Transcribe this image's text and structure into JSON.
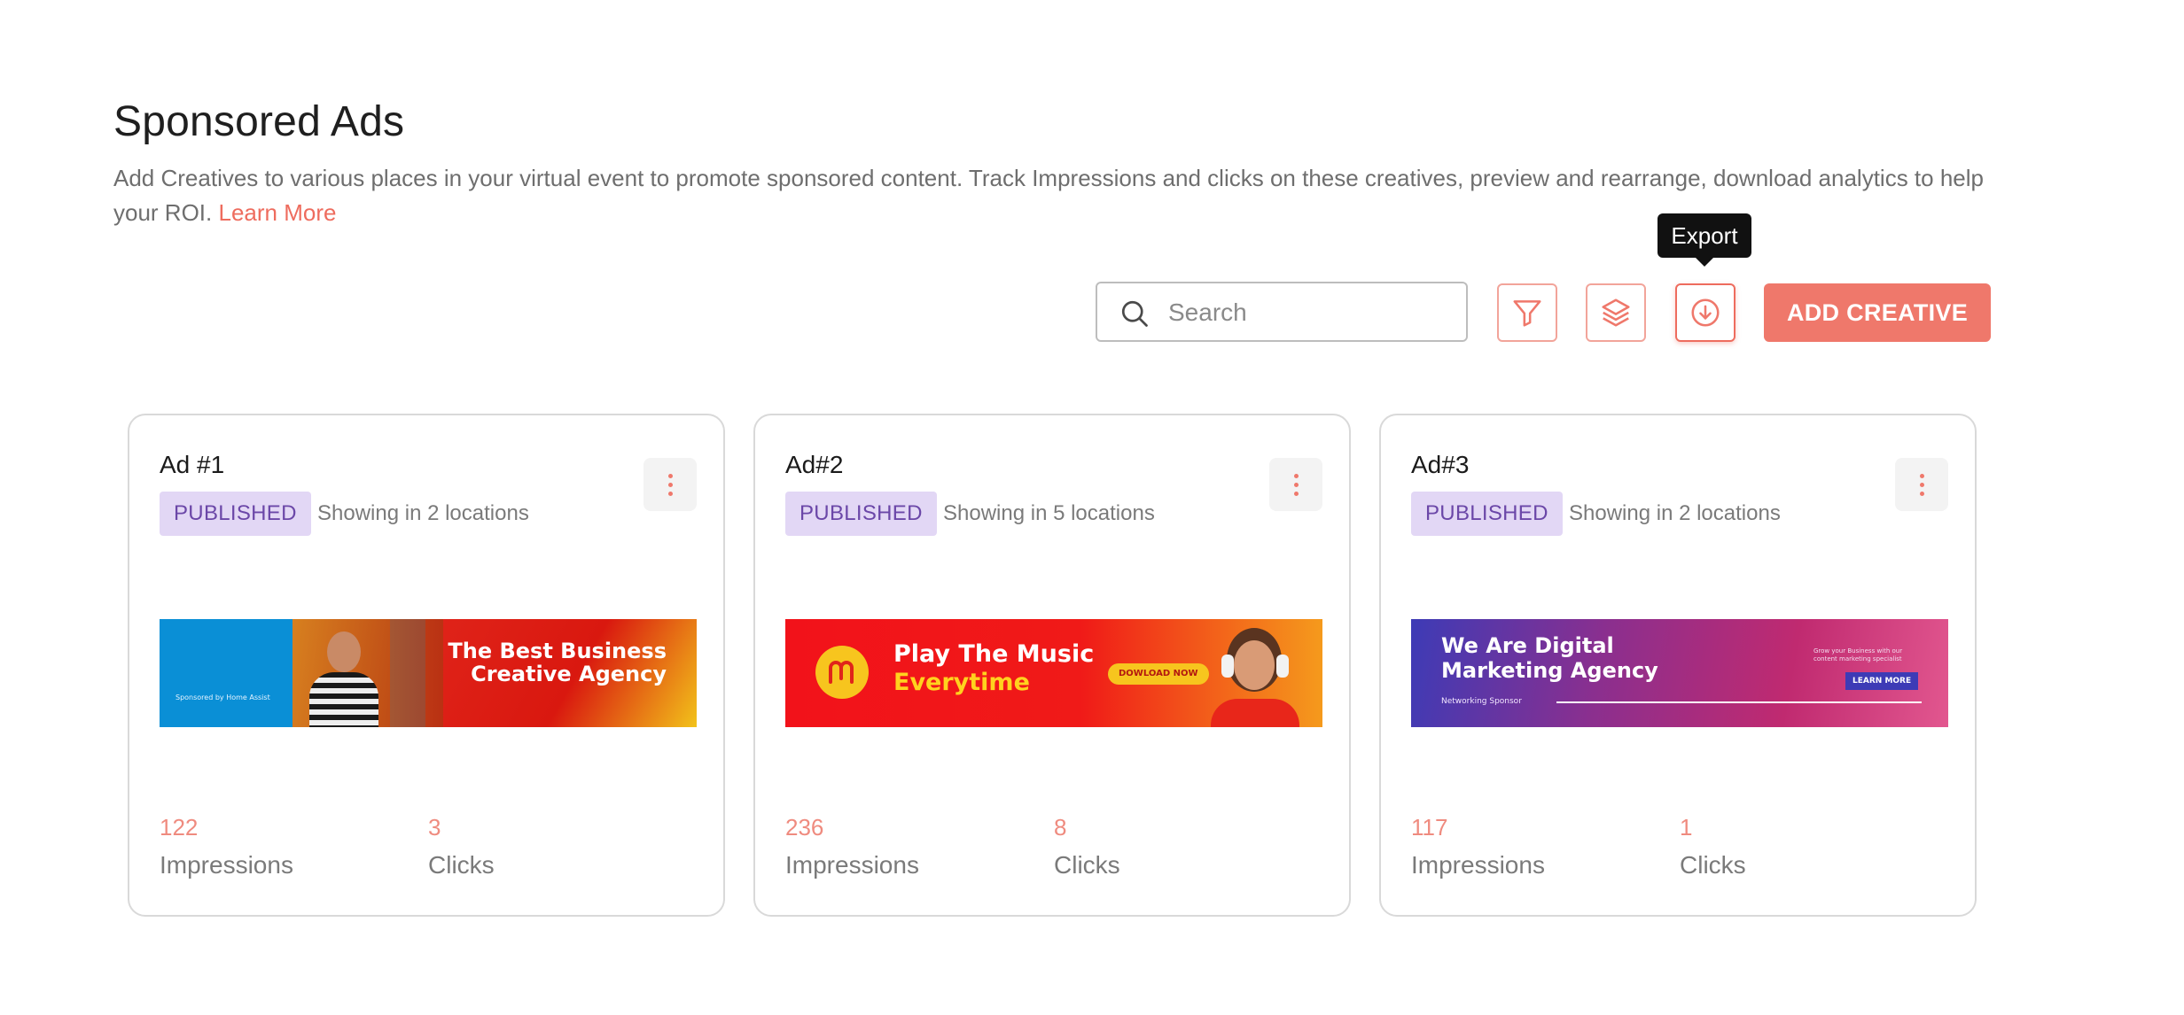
{
  "header": {
    "title": "Sponsored Ads",
    "description": "Add Creatives to various places in your virtual event to promote sponsored content. Track Impressions and clicks on these creatives, preview and rearrange, download analytics to help your ROI.",
    "learn_more": "Learn More"
  },
  "toolbar": {
    "search_placeholder": "Search",
    "filter_icon": "filter-icon",
    "layers_icon": "layers-icon",
    "export_icon": "download-circle-icon",
    "export_tooltip": "Export",
    "add_label": "ADD CREATIVE",
    "accent": "#ef786b"
  },
  "cards": [
    {
      "title": "Ad #1",
      "status": "PUBLISHED",
      "locations": "Showing in 2 locations",
      "impressions": "122",
      "impressions_label": "Impressions",
      "clicks": "3",
      "clicks_label": "Clicks",
      "banner": {
        "line1": "The Best Business",
        "line2": "Creative Agency",
        "small": "Sponsored by Home Assist"
      }
    },
    {
      "title": "Ad#2",
      "status": "PUBLISHED",
      "locations": "Showing in 5 locations",
      "impressions": "236",
      "impressions_label": "Impressions",
      "clicks": "8",
      "clicks_label": "Clicks",
      "banner": {
        "line1": "Play The Music",
        "line2": "Everytime",
        "cta": "DOWLOAD NOW"
      }
    },
    {
      "title": "Ad#3",
      "status": "PUBLISHED",
      "locations": "Showing in 2 locations",
      "impressions": "117",
      "impressions_label": "Impressions",
      "clicks": "1",
      "clicks_label": "Clicks",
      "banner": {
        "line1": "We Are Digital",
        "line2": "Marketing Agency",
        "small": "Networking Sponsor",
        "side_text": "Grow your Business with our content marketing specialist",
        "cta": "LEARN MORE"
      }
    }
  ],
  "colors": {
    "badge_bg": "#e2d7f5",
    "badge_text": "#6b47a8",
    "stat_number": "#ef8b7f"
  }
}
